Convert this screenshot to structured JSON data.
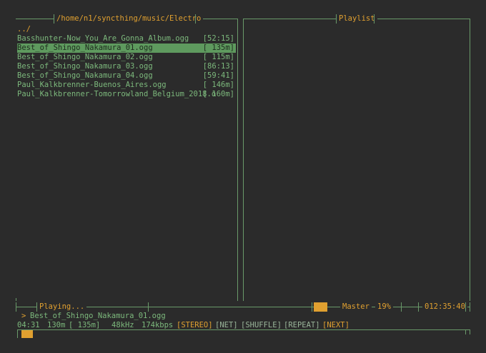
{
  "browser": {
    "path": "/home/n1/syncthing/music/Electro",
    "parent": "../",
    "files": [
      {
        "name": "Basshunter-Now_You_Are_Gonna_Album.ogg",
        "size": "[52:15]",
        "selected": false
      },
      {
        "name": "Best_of_Shingo_Nakamura_01.ogg",
        "size": "[ 135m]",
        "selected": true
      },
      {
        "name": "Best_of_Shingo_Nakamura_02.ogg",
        "size": "[ 115m]",
        "selected": false
      },
      {
        "name": "Best_of_Shingo_Nakamura_03.ogg",
        "size": "[86:13]",
        "selected": false
      },
      {
        "name": "Best_of_Shingo_Nakamura_04.ogg",
        "size": "[59:41]",
        "selected": false
      },
      {
        "name": "Paul_Kalkbrenner-Buenos_Aires.ogg",
        "size": "[ 146m]",
        "selected": false
      },
      {
        "name": "Paul_Kalkbrenner-Tomorrowland_Belgium_2018.o",
        "size": "[ 160m]",
        "selected": false
      }
    ]
  },
  "playlist": {
    "title": "Playlist"
  },
  "status": {
    "playing_label": "Playing...",
    "mixer_label": "Master",
    "volume": "19%",
    "volume_fraction": 0.19,
    "clock": "012:35:40",
    "current_track_prefix": ">",
    "current_track": "Best_of_Shingo_Nakamura_01.ogg",
    "elapsed": "04:31",
    "total": "130m",
    "file_length": "[ 135m]",
    "samplerate": "48kHz",
    "bitrate": "174kbps",
    "flags": {
      "stereo": "[STEREO]",
      "net": "[NET]",
      "shuffle": "[SHUFFLE]",
      "repeat": "[REPEAT]",
      "next": "[NEXT]"
    },
    "progress_fraction": 0.035
  },
  "colors": {
    "background": "#2b2b2b",
    "text": "#7cb87c",
    "accent": "#e0a030",
    "selection": "#5e9a5e",
    "border": "#6a9a6a"
  }
}
